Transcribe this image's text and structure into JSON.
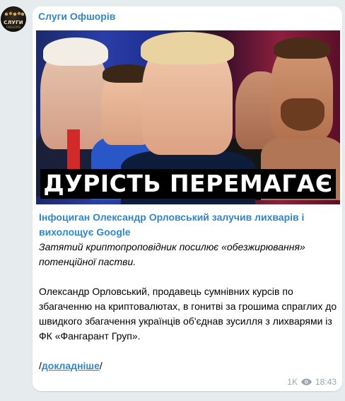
{
  "channel": {
    "name": "Слуги Офшорів",
    "avatar_text": "СЛУГИ",
    "avatar_subtext": "ОФШОРІВ"
  },
  "post": {
    "thumbnail_caption": "ДУРІСТЬ ПЕРЕМАГАЄ",
    "title": "Інфоциган Олександр Орловський залучив лихварів і вихолощує Google",
    "subtitle": "Затятий криптопроповідник посилює «обезжирювання» потенційної пастви.",
    "body": "Олександр Орловський, продавець сумнівних курсів по збагаченню на криптовалютах, в гонитві за грошима спраглих до швидкого збагачення українців об'єднав зусилля з лихварями із ФК «Фангарант Груп».",
    "more_prefix": "/",
    "more_link": "докладніше",
    "more_suffix": "/",
    "views": "1K",
    "time": "18:43",
    "views_icon": "eye-icon"
  },
  "colors": {
    "accent": "#2f87c8",
    "background": "#e6ebee",
    "meta": "#9aa3ad"
  }
}
